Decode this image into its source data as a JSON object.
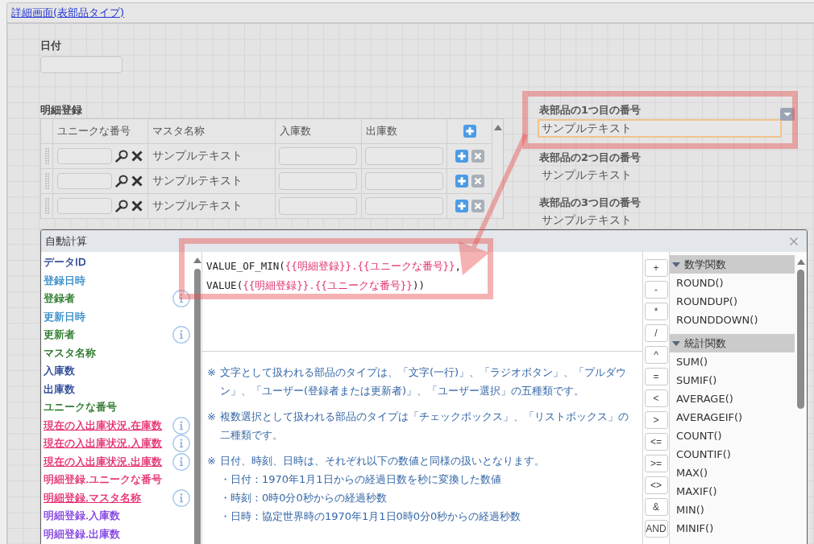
{
  "page": {
    "title_link": "詳細画面(表部品タイプ)"
  },
  "date_field": {
    "label": "日付"
  },
  "detail_table": {
    "label": "明細登録",
    "columns": [
      {
        "label": "ユニークな番号",
        "kind": "lookup"
      },
      {
        "label": "マスタ名称",
        "kind": "text"
      },
      {
        "label": "入庫数",
        "kind": "input"
      },
      {
        "label": "出庫数",
        "kind": "input"
      }
    ],
    "rows": [
      {
        "text": "サンプルテキスト"
      },
      {
        "text": "サンプルテキスト"
      },
      {
        "text": "サンプルテキスト"
      }
    ]
  },
  "table_number_fields": [
    {
      "label": "表部品の1つ目の番号",
      "value": "サンプルテキスト",
      "selected": true
    },
    {
      "label": "表部品の2つ目の番号",
      "value": "サンプルテキスト",
      "selected": false
    },
    {
      "label": "表部品の3つ目の番号",
      "value": "サンプルテキスト",
      "selected": false
    }
  ],
  "auto_calc_dialog": {
    "title": "自動計算",
    "fields": [
      {
        "text": "データID",
        "color": "#1f3d8f",
        "underlined": false,
        "info": false
      },
      {
        "text": "登録日時",
        "color": "#2b86c6",
        "underlined": false,
        "info": false
      },
      {
        "text": "登録者",
        "color": "#1b6f1b",
        "underlined": false,
        "info": true
      },
      {
        "text": "更新日時",
        "color": "#2b86c6",
        "underlined": false,
        "info": false
      },
      {
        "text": "更新者",
        "color": "#1b6f1b",
        "underlined": false,
        "info": true
      },
      {
        "text": "マスタ名称",
        "color": "#1b6f1b",
        "underlined": false,
        "info": false
      },
      {
        "text": "入庫数",
        "color": "#1f3d8f",
        "underlined": false,
        "info": false
      },
      {
        "text": "出庫数",
        "color": "#1f3d8f",
        "underlined": false,
        "info": false
      },
      {
        "text": "ユニークな番号",
        "color": "#1b6f1b",
        "underlined": false,
        "info": false
      },
      {
        "text": "現在の入出庫状況.在庫数",
        "color": "#e5266b",
        "underlined": true,
        "info": true
      },
      {
        "text": "現在の入出庫状況.入庫数",
        "color": "#e5266b",
        "underlined": true,
        "info": true
      },
      {
        "text": "現在の入出庫状況.出庫数",
        "color": "#e5266b",
        "underlined": true,
        "info": true
      },
      {
        "text": "明細登録.ユニークな番号",
        "color": "#e5266b",
        "underlined": false,
        "info": false
      },
      {
        "text": "明細登録.マスタ名称",
        "color": "#e5266b",
        "underlined": true,
        "info": true
      },
      {
        "text": "明細登録.入庫数",
        "color": "#7b36e0",
        "underlined": false,
        "info": false
      },
      {
        "text": "明細登録.出庫数",
        "color": "#7b36e0",
        "underlined": false,
        "info": false
      }
    ],
    "formula": [
      {
        "segments": [
          {
            "kind": "code",
            "text": "VALUE_OF_MIN("
          },
          {
            "kind": "ref",
            "text": "{{明細登録}}.{{ユニークな番号}}"
          },
          {
            "kind": "code",
            "text": ","
          }
        ]
      },
      {
        "segments": [
          {
            "kind": "code",
            "text": "VALUE("
          },
          {
            "kind": "ref",
            "text": "{{明細登録}}.{{ユニークな番号}}"
          },
          {
            "kind": "code",
            "text": "))"
          }
        ]
      }
    ],
    "notes": [
      {
        "mark": "※",
        "text": "文字として扱われる部品のタイプは、「文字(一行)」、「ラジオボタン」、「プルダウン」、「ユーザー(登録者または更新者)」、「ユーザー選択」の五種類です。"
      },
      {
        "mark": "※",
        "text": "複数選択として扱われる部品のタイプは「チェックボックス」、「リストボックス」の二種類です。"
      },
      {
        "mark": "※",
        "text": "日付、時刻、日時は、それぞれ以下の数値と同様の扱いとなります。",
        "items": [
          "・日付：1970年1月1日からの経過日数を秒に変換した数値",
          "・時刻：0時0分0秒からの経過秒数",
          "・日時：協定世界時の1970年1月1日0時0分0秒からの経過秒数"
        ]
      }
    ],
    "operators": [
      "+",
      "-",
      "*",
      "/",
      "^",
      "=",
      "<",
      ">",
      "<=",
      ">=",
      "<>",
      "&",
      "AND"
    ],
    "function_groups": [
      {
        "name": "数学関数",
        "expanded": true,
        "items": [
          "ROUND()",
          "ROUNDUP()",
          "ROUNDDOWN()"
        ]
      },
      {
        "name": "統計関数",
        "expanded": true,
        "items": [
          "SUM()",
          "SUMIF()",
          "AVERAGE()",
          "AVERAGEIF()",
          "COUNT()",
          "COUNTIF()",
          "MAX()",
          "MAXIF()",
          "MIN()",
          "MINIF()"
        ]
      }
    ]
  }
}
